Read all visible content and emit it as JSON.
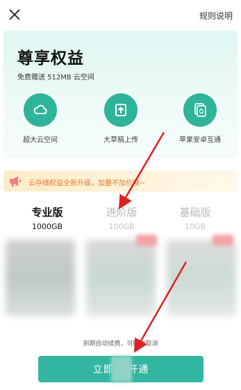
{
  "header": {
    "close_icon": "close-icon",
    "rules_label": "规则说明"
  },
  "benefits": {
    "title": "尊享权益",
    "subtitle": "免费赠送 512MB 云空间",
    "features": [
      {
        "icon": "cloud-icon",
        "label": "超大云空间"
      },
      {
        "icon": "upload-icon",
        "label": "大草稿上传"
      },
      {
        "icon": "sync-icon",
        "label": "苹果安卓互通"
      }
    ],
    "accent_color": "#2fb39a"
  },
  "notice": {
    "icon": "megaphone-icon",
    "text": "云存储权益全新升级，加量不加价哦~"
  },
  "plans": [
    {
      "name": "专业版",
      "size": "1000GB",
      "selected": true
    },
    {
      "name": "进阶版",
      "size": "100GB",
      "selected": false
    },
    {
      "name": "基础版",
      "size": "10GB",
      "selected": false
    }
  ],
  "renew_note": "到期自动续费，可随时取消",
  "cta": {
    "label": "立即以  开通",
    "color": "#33b6a1"
  }
}
